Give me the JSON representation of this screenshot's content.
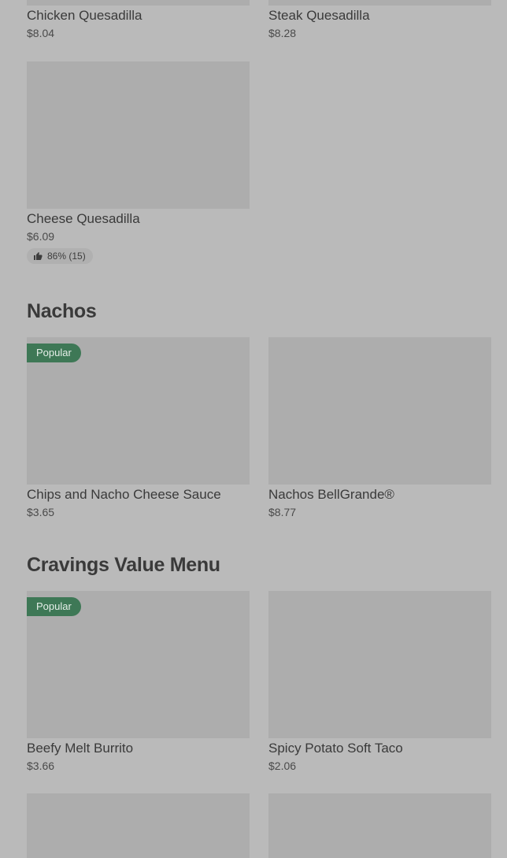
{
  "quesadillas": {
    "items": [
      {
        "name": "Chicken Quesadilla",
        "price": "$8.04"
      },
      {
        "name": "Steak Quesadilla",
        "price": "$8.28"
      },
      {
        "name": "Cheese Quesadilla",
        "price": "$6.09",
        "rating": "86% (15)"
      }
    ]
  },
  "nachos": {
    "title": "Nachos",
    "items": [
      {
        "name": "Chips and Nacho Cheese Sauce",
        "price": "$3.65",
        "badge": "Popular"
      },
      {
        "name": "Nachos BellGrande®",
        "price": "$8.77"
      }
    ]
  },
  "cravings": {
    "title": "Cravings Value Menu",
    "items": [
      {
        "name": "Beefy Melt Burrito",
        "price": "$3.66",
        "badge": "Popular"
      },
      {
        "name": "Spicy Potato Soft Taco",
        "price": "$2.06"
      }
    ]
  },
  "icons": {
    "rating": "thumbs-up-icon"
  },
  "colors": {
    "badge_bg": "#3e7856",
    "image_placeholder": "#adadad",
    "background": "#bababa"
  }
}
